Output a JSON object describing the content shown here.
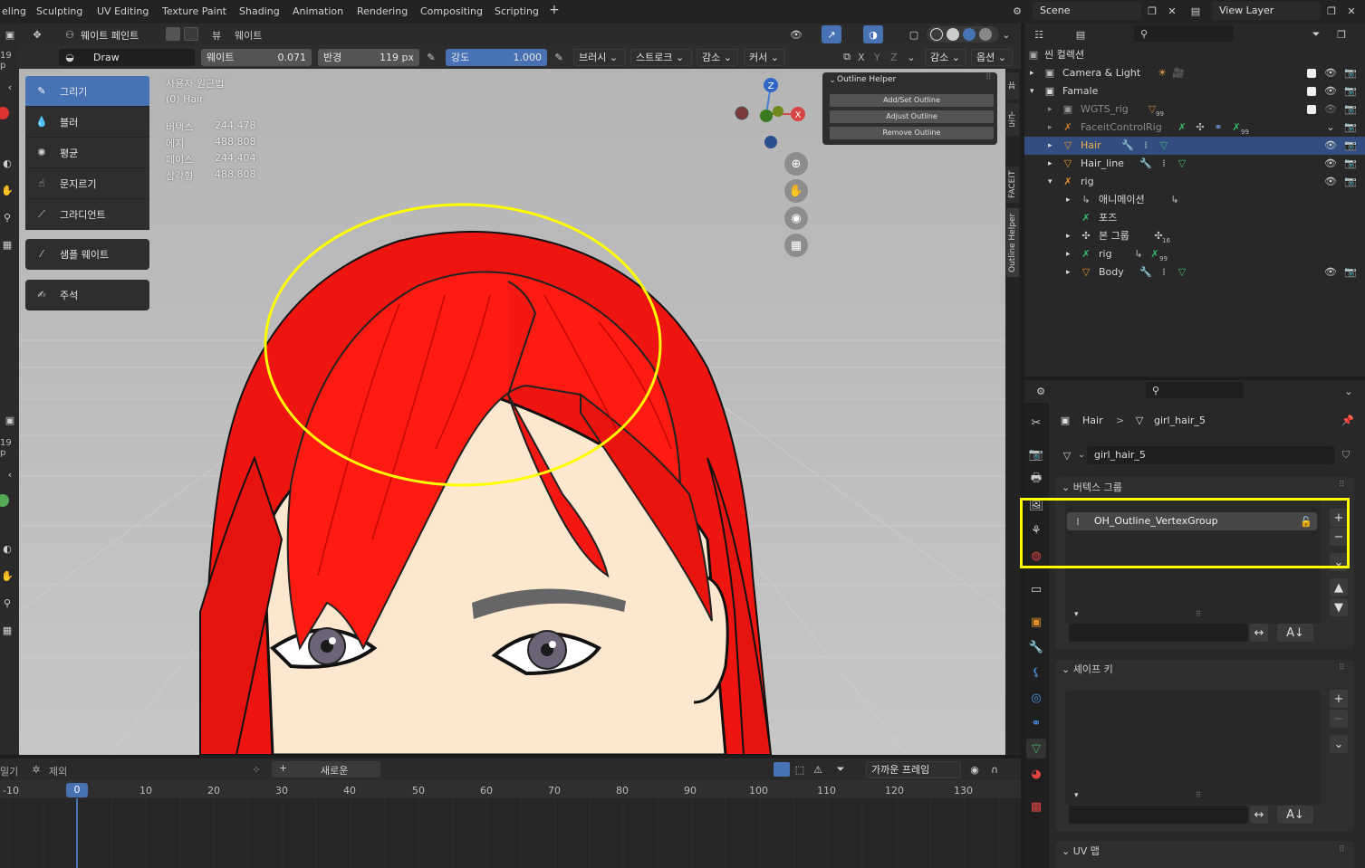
{
  "topbar": {
    "workspaces": [
      "eling",
      "Sculpting",
      "UV Editing",
      "Texture Paint",
      "Shading",
      "Animation",
      "Rendering",
      "Compositing",
      "Scripting"
    ],
    "add": "+",
    "scene": "Scene",
    "view_layer": "View Layer"
  },
  "header": {
    "mode": "웨이트 페인트",
    "view": "뷰",
    "weight_menu": "웨이트"
  },
  "toolsettings": {
    "brush": "Draw",
    "weight_label": "웨이트",
    "weight_value": "0.071",
    "radius_label": "반경",
    "radius_value": "119 px",
    "strength_label": "강도",
    "strength_value": "1.000",
    "brushes": "브러시",
    "stroke": "스트로크",
    "falloff": "감소",
    "cursor": "커서",
    "falloff2": "감소",
    "options": "옵션",
    "axis_x": "X",
    "axis_y": "Y",
    "axis_z": "Z"
  },
  "tools": {
    "draw": "그리기",
    "blur": "블러",
    "average": "평균",
    "smear": "문지르기",
    "gradient": "그라디언트",
    "sample": "샘플 웨이트",
    "annotate": "주석"
  },
  "viewport": {
    "view_name": "사용자 원근법",
    "object": "(0) Hair",
    "stats": [
      {
        "k": "버텍스",
        "v": "244,478"
      },
      {
        "k": "에지",
        "v": "488,808"
      },
      {
        "k": "페이스",
        "v": "244,404"
      },
      {
        "k": "삼각형",
        "v": "488,808"
      }
    ]
  },
  "gizmo": {
    "z": "Z",
    "x": "X"
  },
  "outline_helper": {
    "title": "Outline Helper",
    "add": "Add/Set Outline",
    "adjust": "Adjust Outline",
    "remove": "Remove Outline"
  },
  "side_tabs": [
    "뷰",
    "도구",
    "FACEIT",
    "Outline Helper"
  ],
  "outliner": {
    "title": "씬 컬렉션",
    "rows": [
      {
        "label": "Camera & Light",
        "badge": ""
      },
      {
        "label": "Famale",
        "badge": ""
      },
      {
        "label": "WGTS_rig",
        "badge": "99"
      },
      {
        "label": "FaceitControlRig",
        "badge": "99"
      },
      {
        "label": "Hair",
        "badge": ""
      },
      {
        "label": "Hair_line",
        "badge": ""
      },
      {
        "label": "rig",
        "badge": ""
      },
      {
        "label": "애니메이션",
        "badge": ""
      },
      {
        "label": "포즈",
        "badge": ""
      },
      {
        "label": "본 그룹",
        "badge": "16"
      },
      {
        "label": "rig",
        "badge": "99"
      },
      {
        "label": "Body",
        "badge": ""
      }
    ]
  },
  "properties": {
    "breadcrumb_obj": "Hair",
    "breadcrumb_sep": ">",
    "breadcrumb_mesh": "girl_hair_5",
    "mesh_name": "girl_hair_5",
    "vgroups_title": "버텍스 그룹",
    "vgroup_item": "OH_Outline_VertexGroup",
    "shape_keys_title": "셰이프 키",
    "uv_title": "UV 맵"
  },
  "timeline": {
    "pull": "밀기",
    "exclude": "제외",
    "new": "새로운",
    "interp": "가까운 프레임",
    "current_frame": "0",
    "ruler": [
      "-10",
      "0",
      "10",
      "20",
      "30",
      "40",
      "50",
      "60",
      "70",
      "80",
      "90",
      "100",
      "110",
      "120",
      "130"
    ]
  },
  "colors": {
    "accent": "#4772b3",
    "highlight": "#ffff00",
    "hair": "#ff1a12",
    "viewport_bg": "#bdbdbd"
  }
}
